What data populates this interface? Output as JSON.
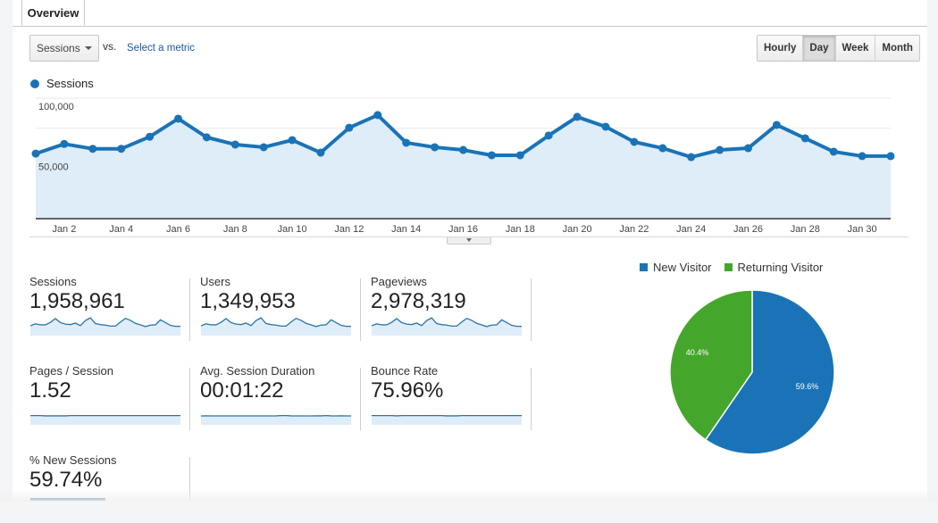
{
  "tabs": [
    {
      "label": "Overview",
      "active": true
    }
  ],
  "metric_selector": {
    "selected": "Sessions",
    "vs_label": "vs.",
    "compare_link": "Select a metric"
  },
  "granularity": {
    "options": [
      "Hourly",
      "Day",
      "Week",
      "Month"
    ],
    "selected": "Day"
  },
  "colors": {
    "primary": "#1a73b6",
    "fill": "#deedf8",
    "returning": "#45a62c"
  },
  "chart_data": [
    {
      "type": "area",
      "title": "",
      "legend": [
        {
          "label": "Sessions",
          "color": "#1a73b6"
        }
      ],
      "legend_position": "top-left",
      "x": [
        "Jan 1",
        "Jan 2",
        "Jan 3",
        "Jan 4",
        "Jan 5",
        "Jan 6",
        "Jan 7",
        "Jan 8",
        "Jan 9",
        "Jan 10",
        "Jan 11",
        "Jan 12",
        "Jan 13",
        "Jan 14",
        "Jan 15",
        "Jan 16",
        "Jan 17",
        "Jan 18",
        "Jan 19",
        "Jan 20",
        "Jan 21",
        "Jan 22",
        "Jan 23",
        "Jan 24",
        "Jan 25",
        "Jan 26",
        "Jan 27",
        "Jan 28",
        "Jan 29",
        "Jan 30",
        "Jan 31"
      ],
      "x_tick_labels": [
        "Jan 2",
        "Jan 4",
        "Jan 6",
        "Jan 8",
        "Jan 10",
        "Jan 12",
        "Jan 14",
        "Jan 16",
        "Jan 18",
        "Jan 20",
        "Jan 22",
        "Jan 24",
        "Jan 26",
        "Jan 28",
        "Jan 30"
      ],
      "series": [
        {
          "name": "Sessions",
          "values": [
            54000,
            62000,
            58000,
            58000,
            68000,
            83000,
            67500,
            61500,
            59300,
            65200,
            54800,
            75500,
            86000,
            63000,
            59300,
            57000,
            52600,
            52600,
            69000,
            84500,
            76300,
            63700,
            58500,
            51100,
            57000,
            58500,
            77800,
            66700,
            55600,
            51900,
            51900
          ]
        }
      ],
      "y_tick_labels": [
        "50,000",
        "100,000"
      ],
      "y_ticks": [
        50000,
        100000
      ],
      "ylim": [
        0,
        100000
      ],
      "grid": true,
      "xlabel": "",
      "ylabel": ""
    },
    {
      "type": "pie",
      "legend": [
        {
          "label": "New Visitor",
          "color": "#1a73b6"
        },
        {
          "label": "Returning Visitor",
          "color": "#45a62c"
        }
      ],
      "legend_position": "top",
      "slices": [
        {
          "label": "New Visitor",
          "value": 59.6,
          "display": "59.6%"
        },
        {
          "label": "Returning Visitor",
          "value": 40.4,
          "display": "40.4%"
        }
      ]
    }
  ],
  "tiles": [
    {
      "label": "Sessions",
      "value": "1,958,961",
      "spark": [
        54,
        62,
        58,
        58,
        68,
        83,
        67,
        61,
        59,
        65,
        55,
        75,
        86,
        63,
        59,
        57,
        53,
        53,
        69,
        84,
        76,
        64,
        58,
        51,
        57,
        58,
        78,
        67,
        56,
        52,
        52
      ],
      "spark_range": [
        0,
        100
      ]
    },
    {
      "label": "Users",
      "value": "1,349,953",
      "spark": [
        54,
        62,
        58,
        58,
        68,
        83,
        67,
        61,
        59,
        65,
        55,
        75,
        86,
        63,
        59,
        57,
        53,
        53,
        69,
        84,
        76,
        64,
        58,
        51,
        57,
        58,
        78,
        67,
        56,
        52,
        52
      ],
      "spark_range": [
        0,
        100
      ]
    },
    {
      "label": "Pageviews",
      "value": "2,978,319",
      "spark": [
        54,
        62,
        58,
        58,
        68,
        83,
        67,
        61,
        59,
        65,
        55,
        75,
        86,
        63,
        59,
        57,
        53,
        53,
        69,
        84,
        76,
        64,
        58,
        51,
        57,
        58,
        78,
        67,
        56,
        52,
        52
      ],
      "spark_range": [
        0,
        100
      ]
    },
    {
      "label": "Pages / Session",
      "value": "1.52",
      "spark": [
        52,
        52,
        52,
        51,
        51,
        51,
        51,
        51,
        52,
        52,
        52,
        52,
        52,
        52,
        52,
        52,
        52,
        52,
        52,
        52,
        52,
        52,
        52,
        52,
        52,
        52,
        52,
        52,
        52,
        52,
        52
      ],
      "spark_range": [
        0,
        100
      ]
    },
    {
      "label": "Avg. Session Duration",
      "value": "00:01:22",
      "spark": [
        50,
        51,
        50,
        49,
        50,
        50,
        48,
        49,
        50,
        49,
        48,
        47,
        47,
        48,
        50,
        51,
        52,
        52,
        51,
        49,
        50,
        49,
        50,
        51,
        51,
        52,
        51,
        50,
        51,
        50,
        50
      ],
      "spark_range": [
        0,
        100
      ]
    },
    {
      "label": "Bounce Rate",
      "value": "75.96%",
      "spark": [
        52,
        52,
        52,
        52,
        52,
        51,
        52,
        52,
        52,
        52,
        52,
        52,
        52,
        52,
        52,
        51,
        51,
        51,
        52,
        52,
        52,
        52,
        52,
        52,
        52,
        52,
        52,
        52,
        52,
        52,
        52
      ],
      "spark_range": [
        0,
        100
      ]
    },
    {
      "label": "% New Sessions",
      "value": "59.74%",
      "spark": [],
      "spark_range": [
        0,
        100
      ]
    }
  ]
}
